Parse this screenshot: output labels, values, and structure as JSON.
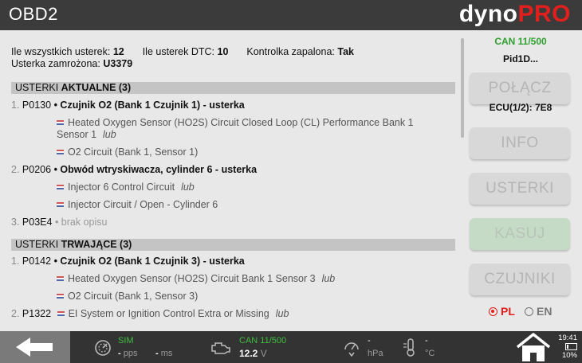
{
  "header": {
    "title": "OBD2",
    "brand_part1": "dyno",
    "brand_part2": "PRO"
  },
  "stats": {
    "total_label": "Ile wszystkich usterek:",
    "total_value": "12",
    "dtc_label": "Ile usterek DTC:",
    "dtc_value": "10",
    "mil_label": "Kontrolka zapalona:",
    "mil_value": "Tak",
    "frozen_label": "Usterka zamrożona:",
    "frozen_value": "U3379"
  },
  "sections": [
    {
      "label_prefix": "USTERKI",
      "label_bold": "AKTUALNE (3)",
      "faults": [
        {
          "num": "1.",
          "code": "P0130",
          "title": "Czujnik O2 (Bank 1 Czujnik 1) - usterka",
          "alts": [
            {
              "line1": "Heated Oxygen Sensor (HO2S) Circuit Closed Loop (CL) Performance Bank 1",
              "line2": "Sensor 1",
              "lub": "lub"
            },
            {
              "text": "O2 Circuit (Bank 1, Sensor 1)"
            }
          ]
        },
        {
          "num": "2.",
          "code": "P0206",
          "title": "Obwód wtryskiwacza, cylinder 6 - usterka",
          "alts": [
            {
              "text": "Injector 6 Control Circuit",
              "lub": "lub"
            },
            {
              "text": "Injector Circuit / Open - Cylinder 6"
            }
          ]
        },
        {
          "num": "3.",
          "code": "P03E4",
          "title": "brak opisu"
        }
      ]
    },
    {
      "label_prefix": "USTERKI",
      "label_bold": "TRWAJĄCE (3)",
      "faults": [
        {
          "num": "1.",
          "code": "P0142",
          "title": "Czujnik O2 (Bank 1 Czujnik 3) - usterka",
          "alts": [
            {
              "text": "Heated Oxygen Sensor (HO2S) Circuit Bank 1 Sensor 3",
              "lub": "lub"
            },
            {
              "text": "O2 Circuit (Bank 1, Sensor 3)"
            }
          ]
        },
        {
          "num": "2.",
          "code": "P1322",
          "alt_inline": {
            "text": "EI System or Ignition Control Extra or Missing",
            "lub": "lub"
          }
        }
      ]
    }
  ],
  "panel": {
    "can_status": "CAN 11/500",
    "pid": "Pid1D...",
    "connect_label": "POŁĄCZ",
    "ecu": "ECU(1/2): 7E8",
    "info_label": "INFO",
    "faults_label": "USTERKI",
    "clear_label": "KASUJ",
    "sensors_label": "CZUJNIKI",
    "lang_pl": "PL",
    "lang_en": "EN",
    "selected_lang": "PL"
  },
  "statusbar": {
    "sim_label": "SIM",
    "pps_value": "-",
    "pps_unit": "pps",
    "ms_value": "-",
    "ms_unit": "ms",
    "can_label": "CAN 11/500",
    "voltage_value": "12.2",
    "voltage_unit": "V",
    "pressure_value": "-",
    "pressure_unit": "hPa",
    "temp_value": "-",
    "temp_unit": "°C",
    "time": "19:41",
    "battery": "10%"
  },
  "colors": {
    "accent_red": "#e0201c",
    "status_green": "#3fbf3f",
    "header_bg": "#3b3b3b"
  },
  "icons": [
    "back-arrow-icon",
    "gauge-icon",
    "engine-icon",
    "pressure-icon",
    "thermometer-icon",
    "home-icon",
    "battery-icon",
    "uk-flag-icon"
  ]
}
